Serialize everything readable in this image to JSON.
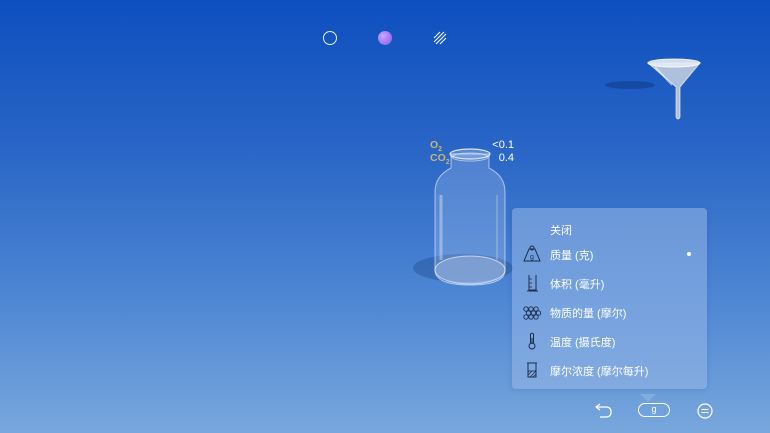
{
  "mode_switcher": {
    "icons": [
      "empty-circle-icon",
      "filled-circle-icon",
      "hatch-icon"
    ]
  },
  "readout": {
    "o2_label": "O",
    "o2_sub": "2",
    "o2_value": "<0.1",
    "co2_label": "CO",
    "co2_sub": "2",
    "co2_value": "0.4"
  },
  "unit_menu": {
    "close_label": "关闭",
    "items": [
      {
        "label": "质量 (克)",
        "icon": "mass-weight-icon",
        "selected": true
      },
      {
        "label": "体积 (毫升)",
        "icon": "graduated-cylinder-icon",
        "selected": false
      },
      {
        "label": "物质的量 (摩尔)",
        "icon": "molecules-icon",
        "selected": false
      },
      {
        "label": "温度 (摄氏度)",
        "icon": "thermometer-icon",
        "selected": false
      },
      {
        "label": "摩尔浓度 (摩尔每升)",
        "icon": "beaker-concentration-icon",
        "selected": false
      }
    ]
  },
  "toolbar": {
    "unit_label": "g",
    "undo_icon": "undo-icon",
    "menu_icon": "menu-icon"
  },
  "colors": {
    "bg_top": "#0d4fbf",
    "bg_bottom": "#78a7dc",
    "mode_accent": "#a37bf2",
    "gas_label": "#c7b27a"
  }
}
